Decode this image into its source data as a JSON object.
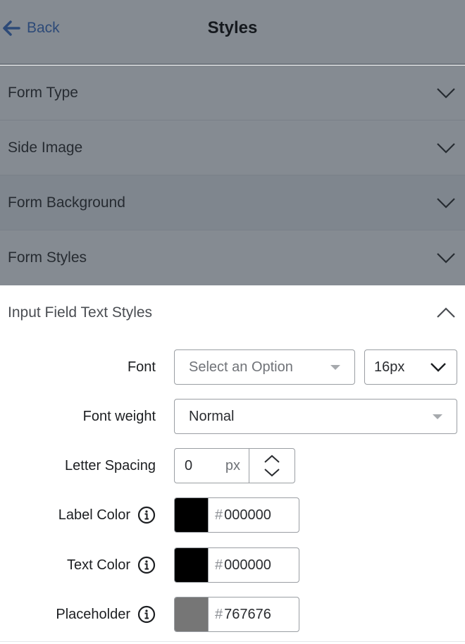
{
  "header": {
    "back_label": "Back",
    "back_icon": "arrow-left-icon",
    "title": "Styles"
  },
  "accordion": [
    {
      "label": "Form Type",
      "expanded": false,
      "icon": "chevron-down-icon"
    },
    {
      "label": "Side Image",
      "expanded": false,
      "icon": "chevron-down-icon"
    },
    {
      "label": "Form Background",
      "expanded": false,
      "icon": "chevron-down-icon"
    },
    {
      "label": "Form Styles",
      "expanded": false,
      "icon": "chevron-down-icon"
    }
  ],
  "open_section": {
    "label": "Input Field Text Styles",
    "expanded": true,
    "icon": "chevron-up-icon",
    "font": {
      "label": "Font",
      "placeholder": "Select an Option",
      "size": "16px"
    },
    "font_weight": {
      "label": "Font weight",
      "value": "Normal"
    },
    "letter_spacing": {
      "label": "Letter Spacing",
      "value": "0",
      "unit": "px"
    },
    "label_color": {
      "label": "Label Color",
      "hash": "#",
      "value": "000000",
      "swatch": "#000000",
      "icon": "info-icon"
    },
    "text_color": {
      "label": "Text Color",
      "hash": "#",
      "value": "000000",
      "swatch": "#000000",
      "icon": "info-icon"
    },
    "placeholder_color": {
      "label": "Placeholder",
      "hash": "#",
      "value": "767676",
      "swatch": "#767676",
      "icon": "info-icon"
    }
  },
  "colors": {
    "overlay": "#858b92",
    "back_link": "#2d4a78"
  }
}
